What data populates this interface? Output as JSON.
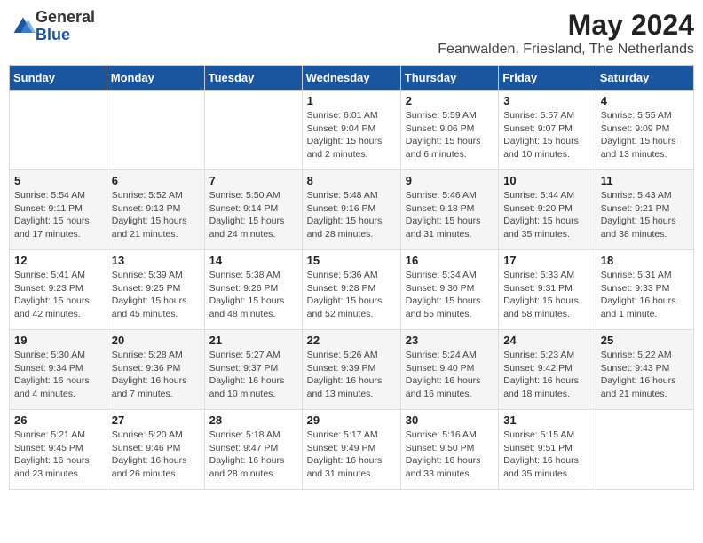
{
  "logo": {
    "general": "General",
    "blue": "Blue"
  },
  "title": "May 2024",
  "location": "Feanwalden, Friesland, The Netherlands",
  "days_of_week": [
    "Sunday",
    "Monday",
    "Tuesday",
    "Wednesday",
    "Thursday",
    "Friday",
    "Saturday"
  ],
  "weeks": [
    [
      {
        "day": "",
        "info": ""
      },
      {
        "day": "",
        "info": ""
      },
      {
        "day": "",
        "info": ""
      },
      {
        "day": "1",
        "info": "Sunrise: 6:01 AM\nSunset: 9:04 PM\nDaylight: 15 hours\nand 2 minutes."
      },
      {
        "day": "2",
        "info": "Sunrise: 5:59 AM\nSunset: 9:06 PM\nDaylight: 15 hours\nand 6 minutes."
      },
      {
        "day": "3",
        "info": "Sunrise: 5:57 AM\nSunset: 9:07 PM\nDaylight: 15 hours\nand 10 minutes."
      },
      {
        "day": "4",
        "info": "Sunrise: 5:55 AM\nSunset: 9:09 PM\nDaylight: 15 hours\nand 13 minutes."
      }
    ],
    [
      {
        "day": "5",
        "info": "Sunrise: 5:54 AM\nSunset: 9:11 PM\nDaylight: 15 hours\nand 17 minutes."
      },
      {
        "day": "6",
        "info": "Sunrise: 5:52 AM\nSunset: 9:13 PM\nDaylight: 15 hours\nand 21 minutes."
      },
      {
        "day": "7",
        "info": "Sunrise: 5:50 AM\nSunset: 9:14 PM\nDaylight: 15 hours\nand 24 minutes."
      },
      {
        "day": "8",
        "info": "Sunrise: 5:48 AM\nSunset: 9:16 PM\nDaylight: 15 hours\nand 28 minutes."
      },
      {
        "day": "9",
        "info": "Sunrise: 5:46 AM\nSunset: 9:18 PM\nDaylight: 15 hours\nand 31 minutes."
      },
      {
        "day": "10",
        "info": "Sunrise: 5:44 AM\nSunset: 9:20 PM\nDaylight: 15 hours\nand 35 minutes."
      },
      {
        "day": "11",
        "info": "Sunrise: 5:43 AM\nSunset: 9:21 PM\nDaylight: 15 hours\nand 38 minutes."
      }
    ],
    [
      {
        "day": "12",
        "info": "Sunrise: 5:41 AM\nSunset: 9:23 PM\nDaylight: 15 hours\nand 42 minutes."
      },
      {
        "day": "13",
        "info": "Sunrise: 5:39 AM\nSunset: 9:25 PM\nDaylight: 15 hours\nand 45 minutes."
      },
      {
        "day": "14",
        "info": "Sunrise: 5:38 AM\nSunset: 9:26 PM\nDaylight: 15 hours\nand 48 minutes."
      },
      {
        "day": "15",
        "info": "Sunrise: 5:36 AM\nSunset: 9:28 PM\nDaylight: 15 hours\nand 52 minutes."
      },
      {
        "day": "16",
        "info": "Sunrise: 5:34 AM\nSunset: 9:30 PM\nDaylight: 15 hours\nand 55 minutes."
      },
      {
        "day": "17",
        "info": "Sunrise: 5:33 AM\nSunset: 9:31 PM\nDaylight: 15 hours\nand 58 minutes."
      },
      {
        "day": "18",
        "info": "Sunrise: 5:31 AM\nSunset: 9:33 PM\nDaylight: 16 hours\nand 1 minute."
      }
    ],
    [
      {
        "day": "19",
        "info": "Sunrise: 5:30 AM\nSunset: 9:34 PM\nDaylight: 16 hours\nand 4 minutes."
      },
      {
        "day": "20",
        "info": "Sunrise: 5:28 AM\nSunset: 9:36 PM\nDaylight: 16 hours\nand 7 minutes."
      },
      {
        "day": "21",
        "info": "Sunrise: 5:27 AM\nSunset: 9:37 PM\nDaylight: 16 hours\nand 10 minutes."
      },
      {
        "day": "22",
        "info": "Sunrise: 5:26 AM\nSunset: 9:39 PM\nDaylight: 16 hours\nand 13 minutes."
      },
      {
        "day": "23",
        "info": "Sunrise: 5:24 AM\nSunset: 9:40 PM\nDaylight: 16 hours\nand 16 minutes."
      },
      {
        "day": "24",
        "info": "Sunrise: 5:23 AM\nSunset: 9:42 PM\nDaylight: 16 hours\nand 18 minutes."
      },
      {
        "day": "25",
        "info": "Sunrise: 5:22 AM\nSunset: 9:43 PM\nDaylight: 16 hours\nand 21 minutes."
      }
    ],
    [
      {
        "day": "26",
        "info": "Sunrise: 5:21 AM\nSunset: 9:45 PM\nDaylight: 16 hours\nand 23 minutes."
      },
      {
        "day": "27",
        "info": "Sunrise: 5:20 AM\nSunset: 9:46 PM\nDaylight: 16 hours\nand 26 minutes."
      },
      {
        "day": "28",
        "info": "Sunrise: 5:18 AM\nSunset: 9:47 PM\nDaylight: 16 hours\nand 28 minutes."
      },
      {
        "day": "29",
        "info": "Sunrise: 5:17 AM\nSunset: 9:49 PM\nDaylight: 16 hours\nand 31 minutes."
      },
      {
        "day": "30",
        "info": "Sunrise: 5:16 AM\nSunset: 9:50 PM\nDaylight: 16 hours\nand 33 minutes."
      },
      {
        "day": "31",
        "info": "Sunrise: 5:15 AM\nSunset: 9:51 PM\nDaylight: 16 hours\nand 35 minutes."
      },
      {
        "day": "",
        "info": ""
      }
    ]
  ]
}
